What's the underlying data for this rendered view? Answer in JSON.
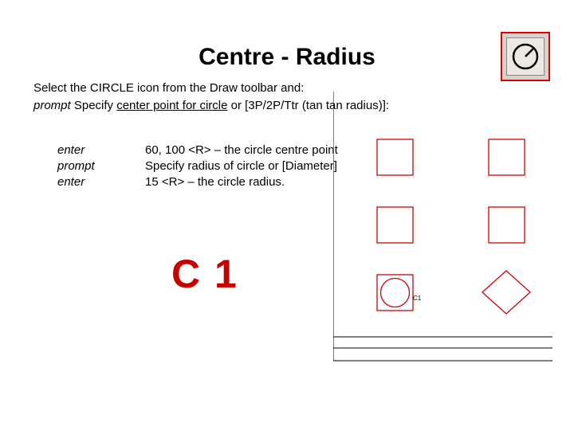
{
  "title": "Centre - Radius",
  "instruction": {
    "line1_a": "Select the CIRCLE icon from the Draw toolbar and:",
    "line2_prefix": "prompt",
    "line2_a": " Specify ",
    "line2_u": "center point for circle",
    "line2_b": " or [3P/2P/Ttr (tan tan radius)]:"
  },
  "steps": [
    {
      "label": "enter",
      "text": "60, 100 <R> – the circle centre point"
    },
    {
      "label": "prompt",
      "text": "Specify radius of circle or [Diameter]"
    },
    {
      "label": "enter",
      "text": "15 <R> – the circle radius."
    }
  ],
  "big_label": "C 1",
  "tool_icon_name": "circle-tool",
  "cad": {
    "circle_label": "C1",
    "stroke": "#d40000"
  }
}
